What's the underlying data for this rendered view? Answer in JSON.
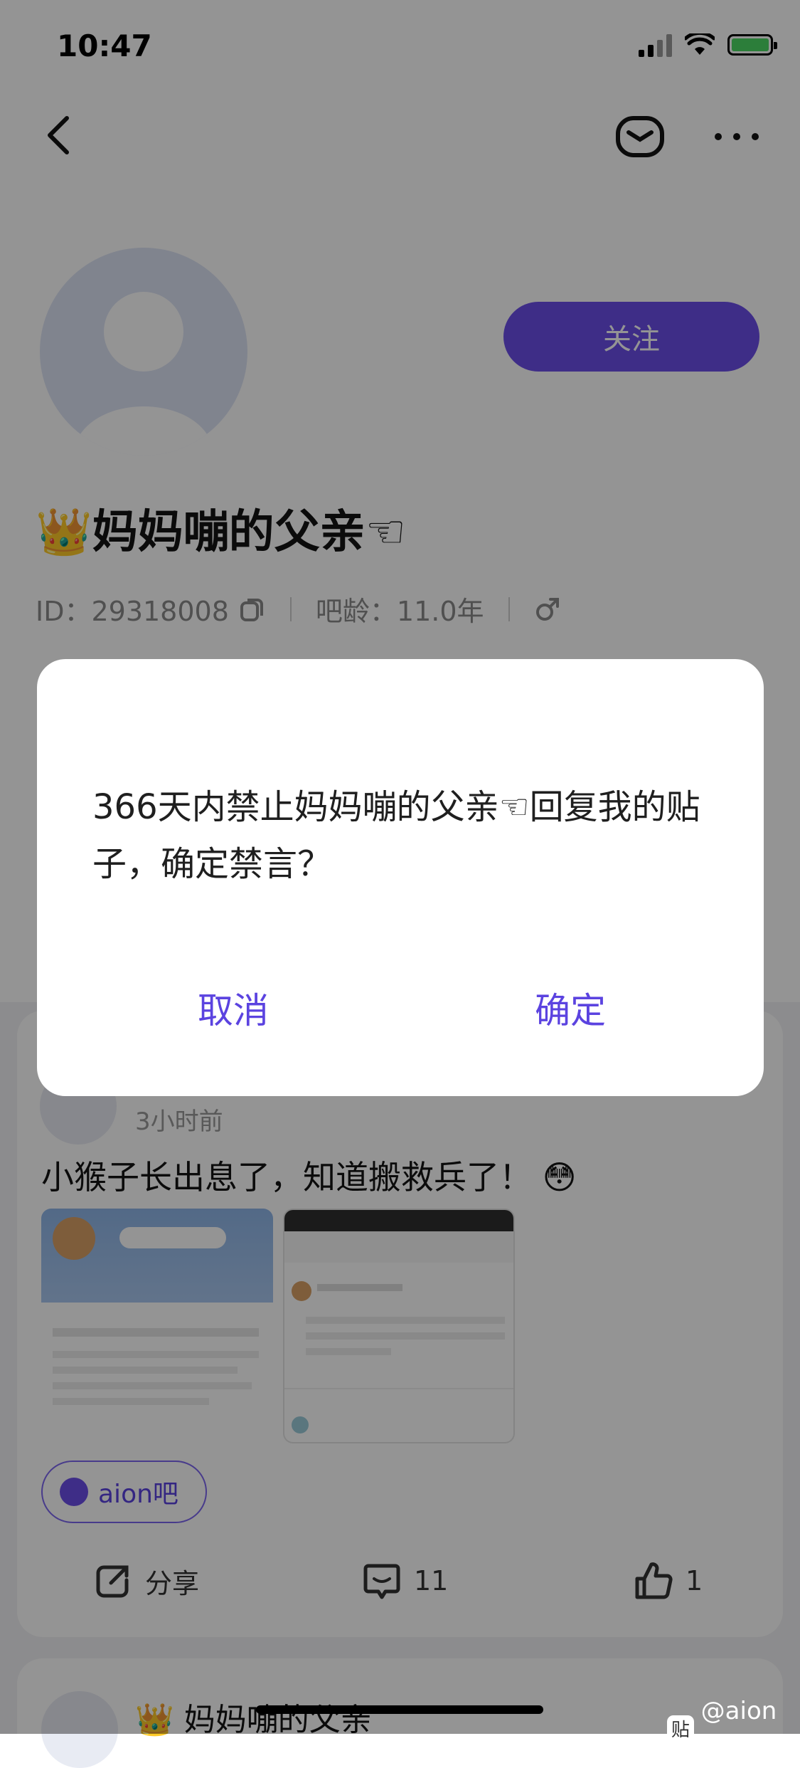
{
  "status_bar": {
    "time": "10:47",
    "icons": [
      "signal-icon",
      "wifi-icon",
      "battery-charging-icon"
    ]
  },
  "nav": {
    "icons": [
      "back-icon",
      "mail-icon",
      "more-icon"
    ]
  },
  "profile": {
    "follow_label": "关注",
    "name": "👑妈妈嘣的父亲☜",
    "id_text": "ID：29318008",
    "bar_age": "吧龄：11.0年",
    "gender_icon": "male-icon"
  },
  "post": {
    "time": "3小时前",
    "text": "小猴子长出息了，知道搬救兵了！ 😳",
    "forum": "aion吧",
    "share_label": "分享",
    "comment_count": "11",
    "like_count": "1"
  },
  "post2": {
    "name": "👑 妈妈嘣的父亲"
  },
  "dialog": {
    "message": "366天内禁止妈妈嘣的父亲☜回复我的贴子，确定禁言？",
    "cancel_label": "取消",
    "confirm_label": "确定"
  },
  "watermark": {
    "text": "@aion吧",
    "logo_text": "贴"
  },
  "colors": {
    "accent": "#6c4fe8",
    "overlay": "rgba(0,0,0,0.42)"
  }
}
